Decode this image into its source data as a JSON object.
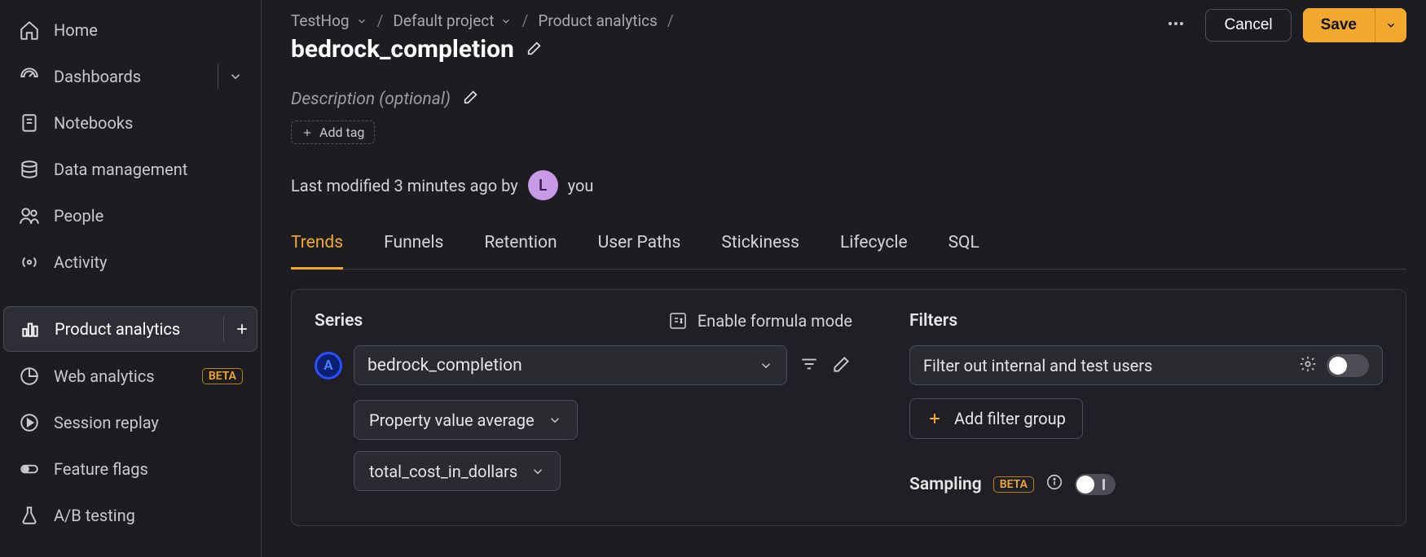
{
  "sidebar": {
    "items": [
      {
        "label": "Home",
        "icon": "home-icon"
      },
      {
        "label": "Dashboards",
        "icon": "gauge-icon",
        "has_chevron": true
      },
      {
        "label": "Notebooks",
        "icon": "notebook-icon"
      },
      {
        "label": "Data management",
        "icon": "database-icon"
      },
      {
        "label": "People",
        "icon": "people-icon"
      },
      {
        "label": "Activity",
        "icon": "radio-icon"
      },
      {
        "label": "Product analytics",
        "icon": "bar-chart-icon",
        "active": true,
        "has_plus": true
      },
      {
        "label": "Web analytics",
        "icon": "pie-chart-icon",
        "badge": "BETA"
      },
      {
        "label": "Session replay",
        "icon": "play-circle-icon"
      },
      {
        "label": "Feature flags",
        "icon": "toggle-icon"
      },
      {
        "label": "A/B testing",
        "icon": "flask-icon"
      }
    ]
  },
  "breadcrumb": {
    "org": "TestHog",
    "project": "Default project",
    "section": "Product analytics"
  },
  "page_title": "bedrock_completion",
  "description_placeholder": "Description (optional)",
  "add_tag_label": "Add tag",
  "last_modified_text": "Last modified 3 minutes ago by",
  "avatar_initial": "L",
  "modified_by_you": "you",
  "actions": {
    "cancel": "Cancel",
    "save": "Save"
  },
  "tabs": [
    "Trends",
    "Funnels",
    "Retention",
    "User Paths",
    "Stickiness",
    "Lifecycle",
    "SQL"
  ],
  "active_tab": "Trends",
  "series": {
    "heading": "Series",
    "formula_label": "Enable formula mode",
    "badge_letter": "A",
    "event_name": "bedrock_completion",
    "aggregation": "Property value average",
    "property": "total_cost_in_dollars"
  },
  "filters": {
    "heading": "Filters",
    "internal_users_label": "Filter out internal and test users",
    "add_filter_group": "Add filter group",
    "sampling_label": "Sampling",
    "sampling_badge": "BETA"
  }
}
